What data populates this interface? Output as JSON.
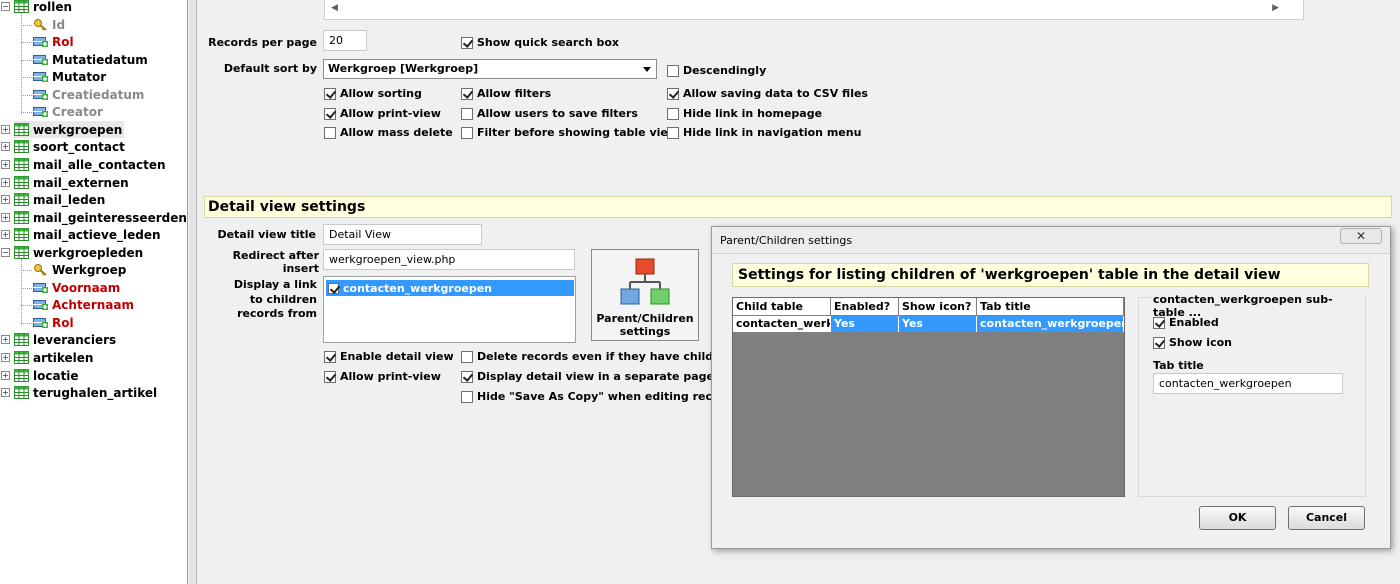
{
  "tree": {
    "nodes": [
      {
        "label": "rollen",
        "kind": "table",
        "expander": "minus",
        "color": "normal"
      },
      {
        "label": "Id",
        "kind": "key",
        "color": "grey"
      },
      {
        "label": "Rol",
        "kind": "field",
        "color": "red"
      },
      {
        "label": "Mutatiedatum",
        "kind": "field",
        "color": "normal"
      },
      {
        "label": "Mutator",
        "kind": "field",
        "color": "normal"
      },
      {
        "label": "Creatiedatum",
        "kind": "field",
        "color": "grey"
      },
      {
        "label": "Creator",
        "kind": "field",
        "color": "grey"
      },
      {
        "label": "werkgroepen",
        "kind": "table",
        "expander": "plus",
        "color": "normal",
        "selected": true
      },
      {
        "label": "soort_contact",
        "kind": "table",
        "expander": "plus",
        "color": "normal"
      },
      {
        "label": "mail_alle_contacten",
        "kind": "table",
        "expander": "plus",
        "color": "normal"
      },
      {
        "label": "mail_externen",
        "kind": "table",
        "expander": "plus",
        "color": "normal"
      },
      {
        "label": "mail_leden",
        "kind": "table",
        "expander": "plus",
        "color": "normal"
      },
      {
        "label": "mail_geinteresseerden",
        "kind": "table",
        "expander": "plus",
        "color": "normal"
      },
      {
        "label": "mail_actieve_leden",
        "kind": "table",
        "expander": "plus",
        "color": "normal"
      },
      {
        "label": "werkgroepleden",
        "kind": "table",
        "expander": "minus",
        "color": "normal"
      },
      {
        "label": "Werkgroep",
        "kind": "key",
        "color": "normal"
      },
      {
        "label": "Voornaam",
        "kind": "field",
        "color": "red"
      },
      {
        "label": "Achternaam",
        "kind": "field",
        "color": "red"
      },
      {
        "label": "Rol",
        "kind": "field",
        "color": "red"
      },
      {
        "label": "leveranciers",
        "kind": "table",
        "expander": "plus",
        "color": "normal"
      },
      {
        "label": "artikelen",
        "kind": "table",
        "expander": "plus",
        "color": "normal"
      },
      {
        "label": "locatie",
        "kind": "table",
        "expander": "plus",
        "color": "normal"
      },
      {
        "label": "terughalen_artikel",
        "kind": "table",
        "expander": "plus",
        "color": "normal"
      }
    ]
  },
  "table_view": {
    "records_per_page_label": "Records per page",
    "records_per_page_value": "20",
    "show_quick_search": {
      "label": "Show quick search box",
      "checked": true
    },
    "default_sort_label": "Default sort by",
    "default_sort_value": "Werkgroep [Werkgroep]",
    "descendingly": {
      "label": "Descendingly",
      "checked": false
    },
    "options": [
      {
        "label": "Allow sorting",
        "checked": true
      },
      {
        "label": "Allow filters",
        "checked": true
      },
      {
        "label": "Allow saving data to CSV files",
        "checked": true
      },
      {
        "label": "Allow print-view",
        "checked": true
      },
      {
        "label": "Allow users to save filters",
        "checked": false
      },
      {
        "label": "Hide link in homepage",
        "checked": false
      },
      {
        "label": "Allow mass delete",
        "checked": false
      },
      {
        "label": "Filter before showing table view",
        "checked": false
      },
      {
        "label": "Hide link in navigation menu",
        "checked": false
      }
    ]
  },
  "detail_view": {
    "section_title": "Detail view settings",
    "title_label": "Detail view title",
    "title_value": "Detail View",
    "redirect_label": "Redirect after insert",
    "redirect_value": "werkgroepen_view.php",
    "display_link_label_1": "Display a link",
    "display_link_label_2": "to children",
    "display_link_label_3": "records from",
    "children_list": [
      {
        "label": "contacten_werkgroepen",
        "checked": true
      }
    ],
    "pc_button_line1": "Parent/Children",
    "pc_button_line2": "settings",
    "options": [
      {
        "label": "Enable detail view",
        "checked": true
      },
      {
        "label": "Delete records even if they have children re",
        "checked": false
      },
      {
        "label": "Allow print-view",
        "checked": true
      },
      {
        "label": "Display detail view in a separate page",
        "checked": true
      },
      {
        "label": "Hide \"Save As Copy\" when editing records",
        "checked": false
      }
    ]
  },
  "dialog": {
    "title": "Parent/Children settings",
    "close_glyph": "✕",
    "heading": "Settings for listing children of 'werkgroepen' table in the detail view",
    "columns": [
      "Child table",
      "Enabled?",
      "Show icon?",
      "Tab title"
    ],
    "rows": [
      [
        "contacten_werkgroepen",
        "Yes",
        "Yes",
        "contacten_werkgroepen"
      ]
    ],
    "sub_panel_title": "contacten_werkgroepen sub-table ...",
    "enabled": {
      "label": "Enabled",
      "checked": true
    },
    "show_icon": {
      "label": "Show icon",
      "checked": true
    },
    "tab_title_label": "Tab title",
    "tab_title_value": "contacten_werkgroepen",
    "ok_label": "OK",
    "cancel_label": "Cancel"
  },
  "colors": {
    "selection": "#3399ff",
    "required_field": "#c00000",
    "section_bg": "#ffffe0"
  }
}
